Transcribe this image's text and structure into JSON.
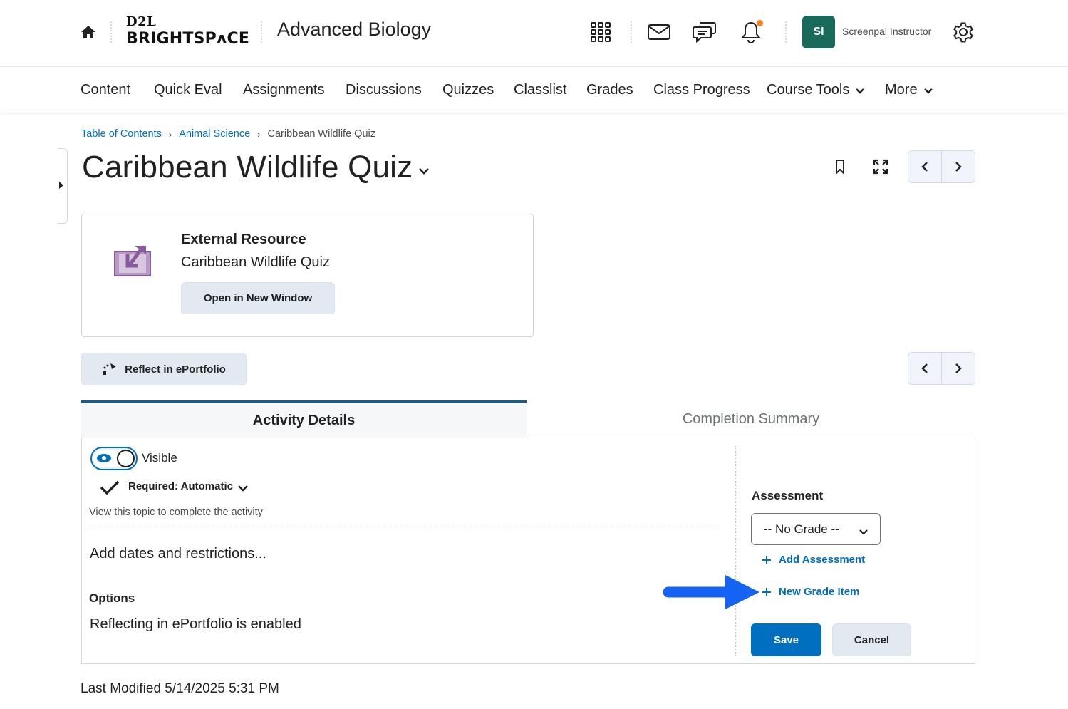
{
  "header": {
    "logo_top": "D2L",
    "logo_main": "BRIGHTSPʌCE",
    "course_title": "Advanced Biology",
    "avatar_initials": "SI",
    "user_name": "Screenpal Instructor",
    "icons": [
      "home-icon",
      "app-grid-icon",
      "mail-icon",
      "chat-icon",
      "bell-icon",
      "gear-icon"
    ],
    "notification_color": "#f5821f"
  },
  "nav": {
    "items": [
      {
        "label": "Content"
      },
      {
        "label": "Quick Eval"
      },
      {
        "label": "Assignments"
      },
      {
        "label": "Discussions"
      },
      {
        "label": "Quizzes"
      },
      {
        "label": "Classlist"
      },
      {
        "label": "Grades"
      },
      {
        "label": "Class Progress"
      },
      {
        "label": "Course Tools"
      },
      {
        "label": "More"
      }
    ]
  },
  "breadcrumb": {
    "items": [
      "Table of Contents",
      "Animal Science",
      "Caribbean Wildlife Quiz"
    ]
  },
  "page": {
    "title": "Caribbean Wildlife Quiz"
  },
  "resource": {
    "type": "External Resource",
    "name": "Caribbean Wildlife Quiz",
    "open_label": "Open in New Window"
  },
  "reflect_button": "Reflect in ePortfolio",
  "tabs": [
    {
      "label": "Activity Details",
      "active": true
    },
    {
      "label": "Completion Summary",
      "active": false
    }
  ],
  "activity": {
    "visibility_label": "Visible",
    "visible": true,
    "required_label": "Required: Automatic",
    "required_hint": "View this topic to complete the activity",
    "dates_link": "Add dates and restrictions...",
    "options_heading": "Options",
    "options_text": "Reflecting in ePortfolio is enabled"
  },
  "assessment": {
    "heading": "Assessment",
    "grade_selected": "-- No Grade --",
    "add_assessment": "Add Assessment",
    "new_grade_item": "New Grade Item",
    "save_label": "Save",
    "cancel_label": "Cancel"
  },
  "footer": {
    "last_modified": "Last Modified 5/14/2025 5:31 PM"
  },
  "colors": {
    "primary": "#006fbf",
    "avatar": "#1a6a5a",
    "annotation_arrow": "#1463f2"
  }
}
